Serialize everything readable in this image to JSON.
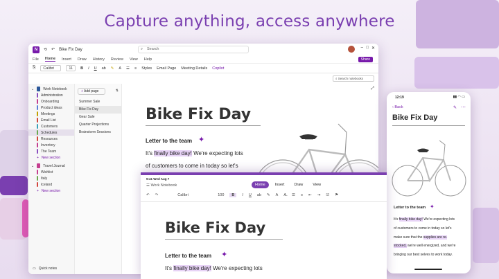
{
  "headline": "Capture anything, access anywhere",
  "desktop": {
    "doc_title": "Bike Fix Day",
    "search_placeholder": "Search",
    "share_label": "Share",
    "menu": [
      "File",
      "Home",
      "Insert",
      "Draw",
      "History",
      "Review",
      "View",
      "Help"
    ],
    "toolbar": {
      "font": "Calibri",
      "size": "11",
      "styles": "Styles",
      "email_page": "Email Page",
      "meeting_details": "Meeting Details",
      "copilot": "Copilot"
    },
    "search_notebooks": "Search notebooks",
    "notebook_name": "Work Notebook",
    "sections": [
      {
        "label": "Administration",
        "color": "#8a4fbf"
      },
      {
        "label": "Onboarding",
        "color": "#c43e8f"
      },
      {
        "label": "Product ideas",
        "color": "#5b7fd6"
      },
      {
        "label": "Meetings",
        "color": "#c2a000"
      },
      {
        "label": "Email List",
        "color": "#d2453d"
      },
      {
        "label": "Customers",
        "color": "#3aa0b8"
      },
      {
        "label": "Schedules",
        "color": "#6aa84f"
      },
      {
        "label": "Resources",
        "color": "#d2453d"
      },
      {
        "label": "Inventory",
        "color": "#c43e8f"
      },
      {
        "label": "The Team",
        "color": "#8a4fbf"
      }
    ],
    "new_section": "New section",
    "notebook2_name": "Travel Journal",
    "sections2": [
      {
        "label": "Wishlist",
        "color": "#c43e8f"
      },
      {
        "label": "Italy",
        "color": "#6aa84f"
      },
      {
        "label": "Iceland",
        "color": "#d2453d"
      }
    ],
    "quick_notes": "Quick notes",
    "add_page": "Add page",
    "pages": [
      "Summer Sale",
      "Bike Fix Day",
      "Gear Sale",
      "Quarter Projections",
      "Brainstorm Sessions"
    ],
    "note_title": "Bike Fix Day",
    "note_subtitle": "Letter to the team",
    "note_line1_pre": "It's ",
    "note_line1_hl": "finally bike day!",
    "note_line1_post": " We're expecting lots",
    "note_line2": "of customers to come in today so let's"
  },
  "tablet": {
    "status_time": "9:41",
    "status_date": "Wed Aug 7",
    "notebook": "Work Notebook",
    "tabs": [
      "Home",
      "Insert",
      "Draw",
      "View"
    ],
    "font": "Calibri",
    "size": "100",
    "note_title": "Bike Fix Day",
    "note_subtitle": "Letter to the team",
    "line1_pre": "It's ",
    "line1_hl": "finally bike day!",
    "line1_post": " We're expecting lots"
  },
  "phone": {
    "time": "12:19",
    "back": "Back",
    "title": "Bike Fix Day",
    "subtitle": "Letter to the team",
    "p1_pre": "It's ",
    "p1_hl": "finally bike day!",
    "p1_post": " We're expecting lots",
    "p2": "of customers to come in today so let's",
    "p3_pre": "make sure that the ",
    "p3_hl": "supplies are re-",
    "p4_hl": "stocked,",
    "p4_post": " we're well energized, and we're",
    "p5": "bringing our best selves to work today."
  }
}
